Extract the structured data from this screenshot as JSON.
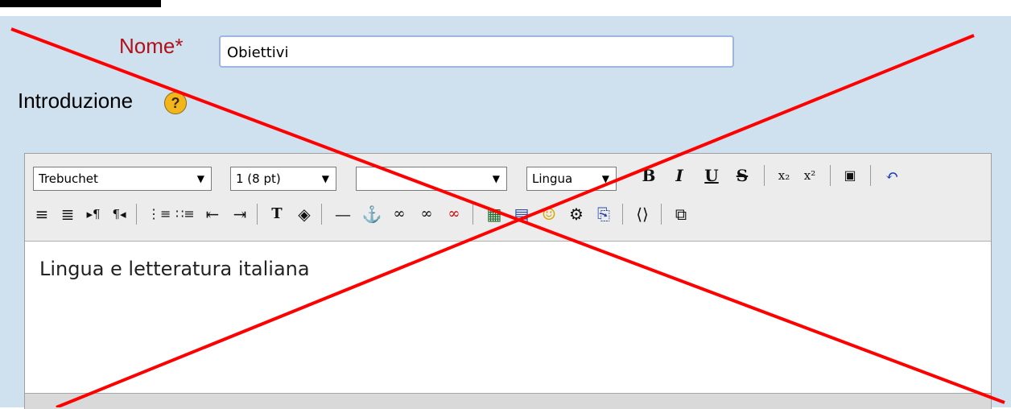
{
  "form": {
    "name_label": "Nome*",
    "name_value": "Obiettivi",
    "intro_label": "Introduzione",
    "help_icon": "?"
  },
  "editor": {
    "font_family": "Trebuchet",
    "font_size": "1 (8 pt)",
    "format": "",
    "language": "Lingua",
    "content": "Lingua e letteratura italiana"
  },
  "colors": {
    "panel_bg": "#cfe0ee",
    "label_red": "#b0121b",
    "cross_red": "#ff0000"
  }
}
